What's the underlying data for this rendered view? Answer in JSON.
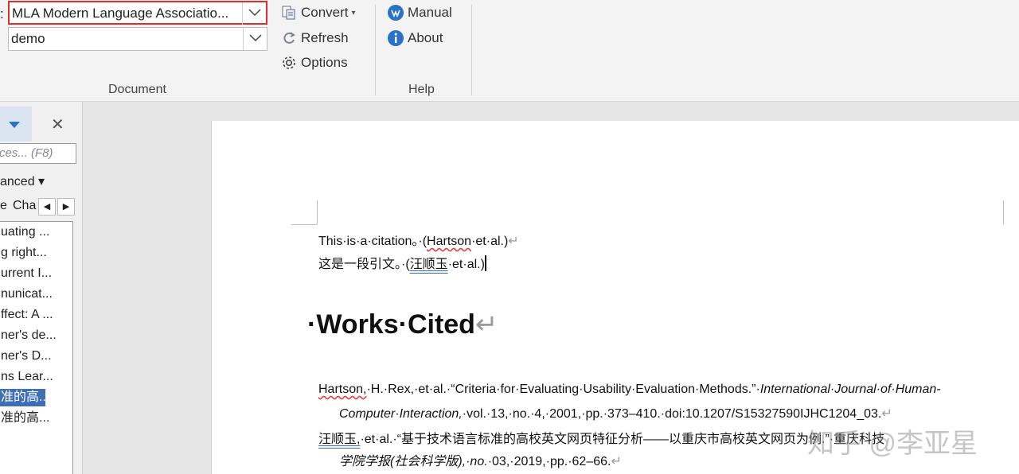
{
  "ribbon": {
    "style_prefix": ":",
    "style_value": "MLA Modern Language Associatio...",
    "library_value": "demo",
    "convert_label": "Convert",
    "convert_caret": "▾",
    "refresh_label": "Refresh",
    "options_label": "Options",
    "manual_label": "Manual",
    "about_label": "About",
    "group_document": "Document",
    "group_help": "Help"
  },
  "pane": {
    "search_placeholder": "ces... (F8)",
    "advanced_label": "anced ▾",
    "tab1": "e",
    "tab2": "Cha",
    "nav_left": "◀",
    "nav_right": "▶",
    "items": [
      "uating ...",
      "g right...",
      "urrent I...",
      "nunicat...",
      "ffect: A ...",
      "ner's de...",
      "ner's D...",
      "ns Lear...",
      "准的高...",
      "准的高..."
    ]
  },
  "doc": {
    "line1_text": "This·is·a·citation。·(",
    "line1_author": "Hartson",
    "line1_rest": "·et·al.)",
    "line2_text": "这是一段引文。·(",
    "line2_author": "汪顺玉",
    "line2_rest": "·et·al.)",
    "heading": "·Works·Cited",
    "ref1_author": "Hartson,",
    "ref1_line1": "·H.·Rex,·et·al.·“Criteria·for·Evaluating·Usability·Evaluation·Methods.”·",
    "ref1_journal1": "International·Journal·of·Human-",
    "ref1_journal2": "Computer·Interaction,",
    "ref1_line2": "·vol.·13,·no.·4,·2001,·pp.·373–410.·doi:10.1207/S15327590IJHC1204_03.",
    "ref2_author": "汪顺玉,",
    "ref2_line1": "·et·al.·“基于技术语言标准的高校英文网页特征分析——以重庆市高校英文网页为例.”·重庆科技",
    "ref2_journal": "学院学报(社会科学版),·no.",
    "ref2_line2": "·03,·2019,·pp.·62–66.",
    "pilcrow": "↵",
    "watermark": "知乎 @李亚星"
  },
  "colors": {
    "highlight_border": "#d9302c",
    "selection": "#3e6fb5",
    "help_icon": "#2a72c8"
  }
}
